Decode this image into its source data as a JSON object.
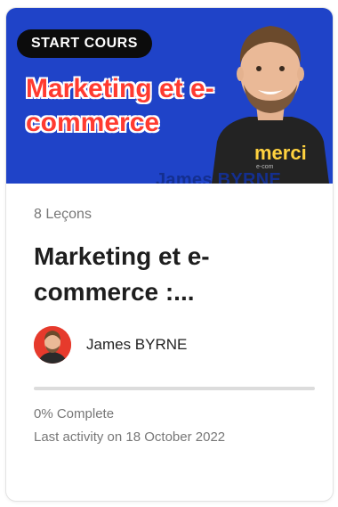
{
  "card": {
    "badge": "START COURS",
    "thumbnail_title": "Marketing et e-commerce",
    "presenter_overlay": "James BYRNE",
    "shirt_text": "merci",
    "lessons": "8 Leçons",
    "title": "Marketing et e-commerce :...",
    "author": "James BYRNE",
    "progress_value": 0,
    "progress_label": "0% Complete",
    "last_activity": "Last activity on 18 October 2022"
  },
  "colors": {
    "thumbnail_bg": "#1f43c8",
    "badge_bg": "#0c0c0c",
    "thumbnail_title": "#ff3b30",
    "shirt_text": "#ffd23f"
  }
}
